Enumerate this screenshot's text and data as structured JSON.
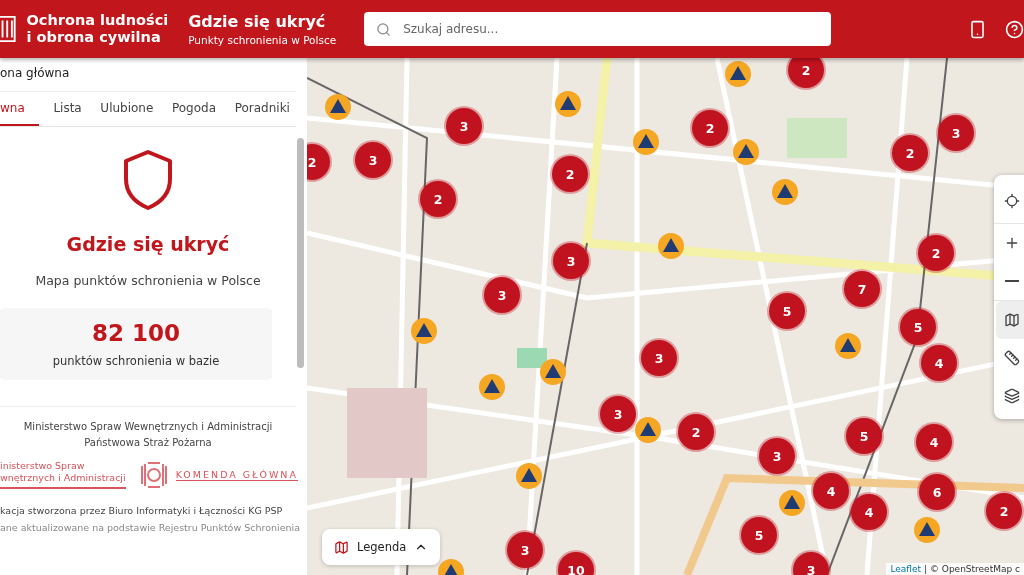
{
  "header": {
    "logo_lines": [
      "Ochrona ludności",
      "i obrona cywilna"
    ],
    "title": "Gdzie się ukryć",
    "subtitle": "Punkty schronienia w Polsce",
    "search": {
      "placeholder": "Szukaj adresu..."
    }
  },
  "sidebar": {
    "breadcrumb": "ona główna",
    "tabs": [
      {
        "label": "wna",
        "selected": true
      },
      {
        "label": "Lista",
        "selected": false
      },
      {
        "label": "Ulubione",
        "selected": false
      },
      {
        "label": "Pogoda",
        "selected": false
      },
      {
        "label": "Poradniki",
        "selected": false
      }
    ],
    "hero_title": "Gdzie się ukryć",
    "hero_subtitle": "Mapa punktów schronienia w Polsce",
    "stat": {
      "value": "82 100",
      "label": "punktów schronienia w bazie"
    },
    "institutions": [
      "Ministerstwo Spraw Wewnętrznych i Administracji",
      "Państwowa Straż Pożarna"
    ],
    "logo_mswia": [
      "inisterstwo Spraw",
      "wnętrznych i Administracji"
    ],
    "logo_kg": "KOMENDA GŁÓWNA",
    "credits": [
      "kacja stworzona przez Biuro Informatyki i Łączności KG PSP",
      "ane aktualizowane na podstawie Rejestru Punktów Schronienia"
    ]
  },
  "map": {
    "clusters": [
      {
        "count": "2"
      },
      {
        "count": "3"
      },
      {
        "count": "2"
      },
      {
        "count": "3"
      },
      {
        "count": "2"
      },
      {
        "count": "3"
      },
      {
        "count": "2"
      },
      {
        "count": "2"
      },
      {
        "count": "2"
      },
      {
        "count": "3"
      },
      {
        "count": "2"
      },
      {
        "count": "3"
      },
      {
        "count": "7"
      },
      {
        "count": "5"
      },
      {
        "count": "5"
      },
      {
        "count": "3"
      },
      {
        "count": "4"
      },
      {
        "count": "3"
      },
      {
        "count": "2"
      },
      {
        "count": "5"
      },
      {
        "count": "3"
      },
      {
        "count": "4"
      },
      {
        "count": "4"
      },
      {
        "count": "6"
      },
      {
        "count": "4"
      },
      {
        "count": "2"
      },
      {
        "count": "3"
      },
      {
        "count": "5"
      },
      {
        "count": "10"
      },
      {
        "count": "3"
      }
    ],
    "controls": [
      {
        "kind": "locate",
        "selected": false
      },
      {
        "kind": "zoom-in",
        "selected": false
      },
      {
        "kind": "zoom-out",
        "selected": false
      },
      {
        "kind": "map",
        "selected": true
      },
      {
        "kind": "measure",
        "selected": false
      },
      {
        "kind": "layers",
        "selected": false
      }
    ],
    "legend": "Legenda",
    "attribution_link": "Leaflet",
    "attribution_text": "| © OpenStreetMap c"
  }
}
